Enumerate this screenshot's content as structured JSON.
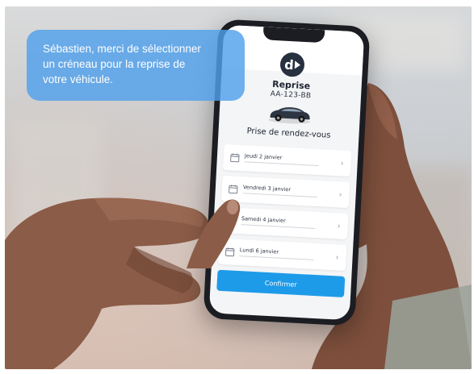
{
  "message": "Sébastien, merci de sélectionner\nun créneau pour la reprise de\nvotre  véhicule.",
  "app": {
    "title": "Reprise",
    "plate": "AA-123-BB",
    "section_title": "Prise de rendez-vous",
    "slots": [
      {
        "label": "Jeudi 2 janvier"
      },
      {
        "label": "Vendredi 3 janvier"
      },
      {
        "label": "Samedi 4 janvier"
      },
      {
        "label": "Lundi 6 janvier"
      }
    ],
    "confirm_label": "Confirmer"
  },
  "colors": {
    "accent": "#1e9be8",
    "bubble": "#50a0eb",
    "logo": "#27303f"
  },
  "icons": {
    "logo": "brand-logo-icon",
    "car": "car-icon",
    "calendar": "calendar-icon",
    "chevron": "chevron-right-icon"
  }
}
